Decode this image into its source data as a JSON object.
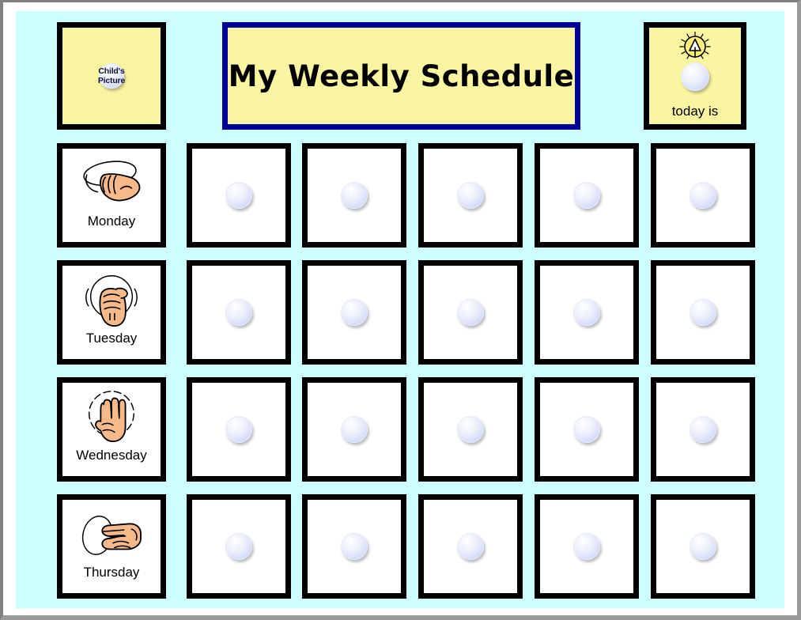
{
  "page": {
    "title": "My Weekly Schedule",
    "background_color": "#cdfdfd",
    "paper_border_color": "#808080"
  },
  "header": {
    "child_picture": {
      "label": "Child's Picture",
      "label_line1": "Child's",
      "label_line2": "Picture",
      "box_color": "#faf5a0",
      "border_color": "#000000",
      "velcro_icon": "velcro-dot-icon"
    },
    "title_card": {
      "text": "My Weekly Schedule",
      "box_color": "#faf5a0",
      "border_color": "#00009b"
    },
    "today_card": {
      "label": "today is",
      "box_color": "#faf5a0",
      "border_color": "#000000",
      "icon": "lamp-sun-icon",
      "velcro_icon": "velcro-dot-icon"
    }
  },
  "grid": {
    "columns": 6,
    "rows": 4,
    "slot_velcro_icon": "velcro-dot-icon",
    "days": [
      {
        "label": "Monday",
        "sign_icon": "asl-hand-monday-icon"
      },
      {
        "label": "Tuesday",
        "sign_icon": "asl-hand-tuesday-icon"
      },
      {
        "label": "Wednesday",
        "sign_icon": "asl-hand-wednesday-icon"
      },
      {
        "label": "Thursday",
        "sign_icon": "asl-hand-thursday-icon"
      }
    ],
    "slots_per_day": 5
  },
  "colors": {
    "cell_background": "#ffffff",
    "cell_border": "#000000",
    "yellow": "#faf5a0",
    "navy": "#00009b",
    "cyan": "#cdfdfd",
    "velcro": "#d8defa",
    "skin": "#f5b98a"
  }
}
